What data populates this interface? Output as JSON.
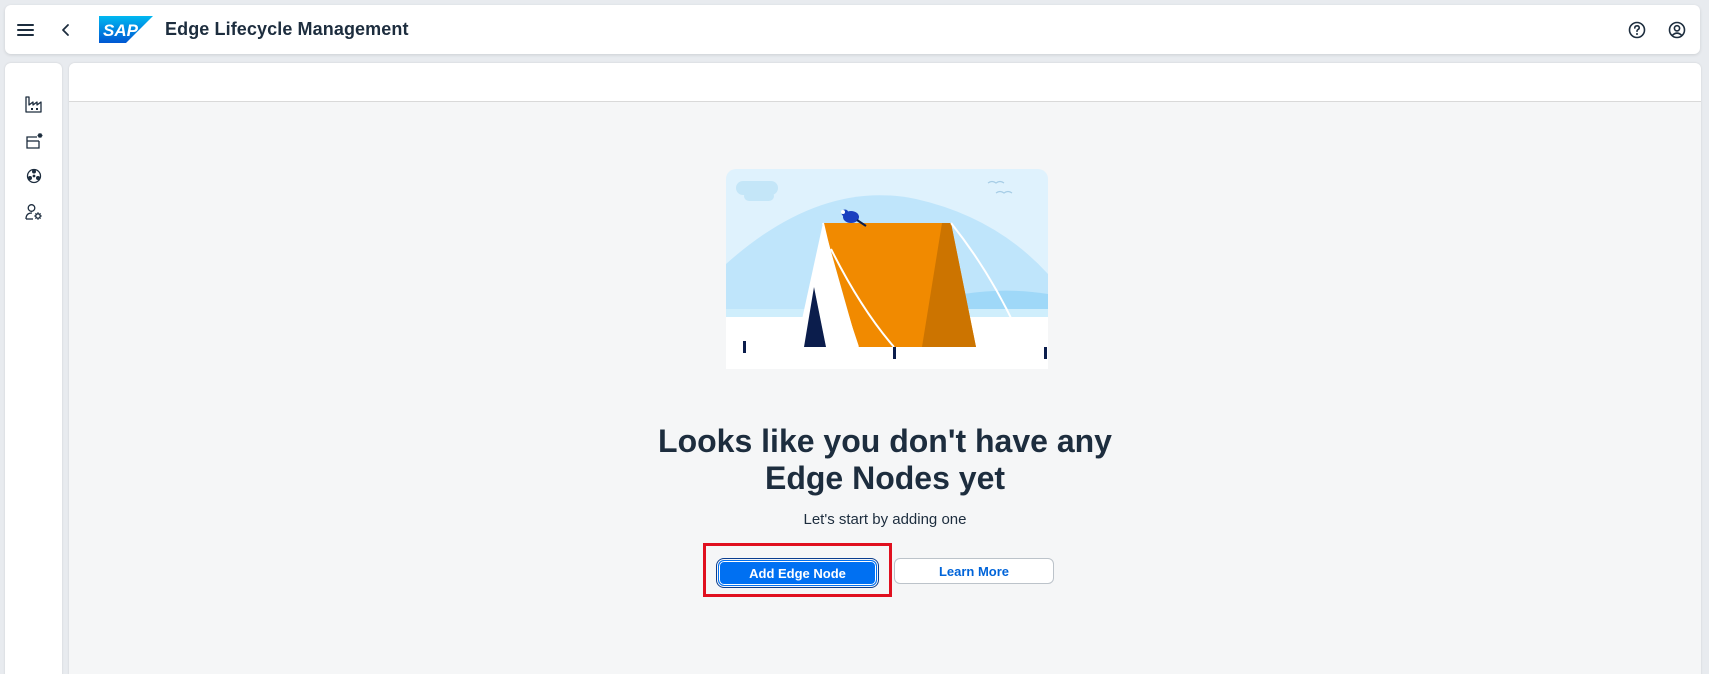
{
  "shellbar": {
    "logo_text": "SAP",
    "title": "Edge Lifecycle Management",
    "icons": [
      "menu-icon",
      "back-icon",
      "help-icon",
      "user-account-icon"
    ]
  },
  "sidenav": {
    "items": [
      {
        "icon": "factory-icon"
      },
      {
        "icon": "product-add-icon"
      },
      {
        "icon": "components-icon"
      },
      {
        "icon": "user-settings-icon"
      }
    ]
  },
  "empty_state": {
    "illustration": "tent-icon",
    "title_line1": "Looks like you don't have any",
    "title_line2": "Edge Nodes yet",
    "subtitle": "Let's start by adding one",
    "primary_button": "Add Edge Node",
    "secondary_button": "Learn More"
  },
  "colors": {
    "accent": "#0070f2",
    "highlight": "#e0101f",
    "tent_orange": "#f18a00",
    "tent_shade": "#cc7400",
    "sky": "#dff2fd"
  }
}
